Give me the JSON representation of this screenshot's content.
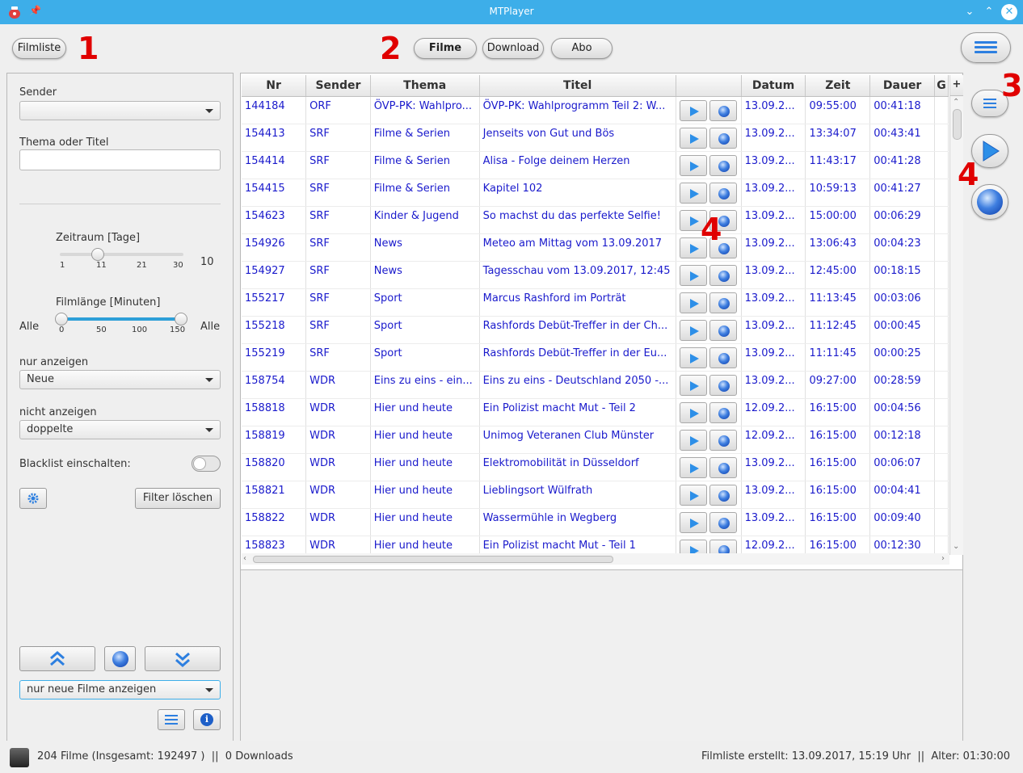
{
  "window": {
    "title": "MTPlayer"
  },
  "toolbar": {
    "filmliste_label": "Filmliste",
    "tab_filme": "Filme",
    "tab_download": "Download",
    "tab_abo": "Abo"
  },
  "markers": {
    "m1": "1",
    "m2": "2",
    "m3": "3",
    "m4a": "4",
    "m4b": "4"
  },
  "filter": {
    "sender_label": "Sender",
    "sender_value": "",
    "thema_label": "Thema oder Titel",
    "thema_value": "",
    "zeitraum_label": "Zeitraum [Tage]",
    "zeitraum_ticks": [
      "1",
      "11",
      "21",
      "30"
    ],
    "zeitraum_value": "10",
    "filmlaenge_label": "Filmlänge [Minuten]",
    "filmlaenge_ticks": [
      "0",
      "50",
      "100",
      "150"
    ],
    "filmlaenge_min": "Alle",
    "filmlaenge_max": "Alle",
    "nur_anzeigen_label": "nur anzeigen",
    "nur_anzeigen_value": "Neue",
    "nicht_anzeigen_label": "nicht anzeigen",
    "nicht_anzeigen_value": "doppelte",
    "blacklist_label": "Blacklist einschalten:",
    "blacklist_on": false,
    "filter_loeschen": "Filter löschen",
    "bottom_combo": "nur neue Filme anzeigen"
  },
  "table": {
    "columns": [
      "Nr",
      "Sender",
      "Thema",
      "Titel",
      "",
      "Datum",
      "Zeit",
      "Dauer",
      "G"
    ],
    "rows": [
      [
        "144184",
        "ORF",
        "ÖVP-PK: Wahlpro...",
        "ÖVP-PK: Wahlprogramm Teil 2: W...",
        "13.09.2...",
        "09:55:00",
        "00:41:18"
      ],
      [
        "154413",
        "SRF",
        "Filme & Serien",
        "Jenseits von Gut und Bös",
        "13.09.2...",
        "13:34:07",
        "00:43:41"
      ],
      [
        "154414",
        "SRF",
        "Filme & Serien",
        "Alisa - Folge deinem Herzen",
        "13.09.2...",
        "11:43:17",
        "00:41:28"
      ],
      [
        "154415",
        "SRF",
        "Filme & Serien",
        "Kapitel 102",
        "13.09.2...",
        "10:59:13",
        "00:41:27"
      ],
      [
        "154623",
        "SRF",
        "Kinder & Jugend",
        "So machst du das perfekte Selfie!",
        "13.09.2...",
        "15:00:00",
        "00:06:29"
      ],
      [
        "154926",
        "SRF",
        "News",
        "Meteo am Mittag vom 13.09.2017",
        "13.09.2...",
        "13:06:43",
        "00:04:23"
      ],
      [
        "154927",
        "SRF",
        "News",
        "Tagesschau vom 13.09.2017, 12:45",
        "13.09.2...",
        "12:45:00",
        "00:18:15"
      ],
      [
        "155217",
        "SRF",
        "Sport",
        "Marcus Rashford im Porträt",
        "13.09.2...",
        "11:13:45",
        "00:03:06"
      ],
      [
        "155218",
        "SRF",
        "Sport",
        "Rashfords Debüt-Treffer in der Ch...",
        "13.09.2...",
        "11:12:45",
        "00:00:45"
      ],
      [
        "155219",
        "SRF",
        "Sport",
        "Rashfords Debüt-Treffer in der Eu...",
        "13.09.2...",
        "11:11:45",
        "00:00:25"
      ],
      [
        "158754",
        "WDR",
        "Eins zu eins - ein...",
        "Eins zu eins - Deutschland 2050 -...",
        "13.09.2...",
        "09:27:00",
        "00:28:59"
      ],
      [
        "158818",
        "WDR",
        "Hier und heute",
        "Ein Polizist macht Mut - Teil 2",
        "12.09.2...",
        "16:15:00",
        "00:04:56"
      ],
      [
        "158819",
        "WDR",
        "Hier und heute",
        "Unimog Veteranen Club Münster",
        "12.09.2...",
        "16:15:00",
        "00:12:18"
      ],
      [
        "158820",
        "WDR",
        "Hier und heute",
        "Elektromobilität in Düsseldorf",
        "13.09.2...",
        "16:15:00",
        "00:06:07"
      ],
      [
        "158821",
        "WDR",
        "Hier und heute",
        "Lieblingsort Wülfrath",
        "13.09.2...",
        "16:15:00",
        "00:04:41"
      ],
      [
        "158822",
        "WDR",
        "Hier und heute",
        "Wassermühle in Wegberg",
        "13.09.2...",
        "16:15:00",
        "00:09:40"
      ],
      [
        "158823",
        "WDR",
        "Hier und heute",
        "Ein Polizist macht Mut - Teil 1",
        "12.09.2...",
        "16:15:00",
        "00:12:30"
      ]
    ]
  },
  "status": {
    "left": "204 Filme (Insgesamt: 192497 )  ||  0 Downloads",
    "right": "Filmliste erstellt: 13.09.2017, 15:19 Uhr  ||  Alter: 01:30:00"
  },
  "colors": {
    "accent": "#3daee9",
    "link": "#1a1acc",
    "marker": "#e00000"
  }
}
